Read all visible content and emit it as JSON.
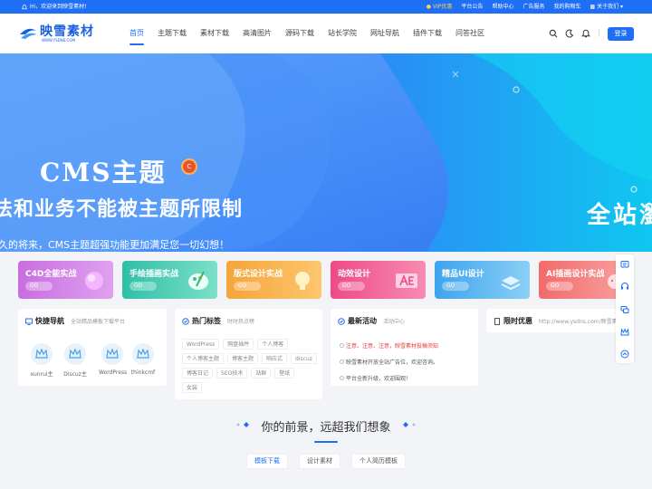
{
  "topbar": {
    "greeting": "Hi，欢迎来到映雪素材!",
    "links": [
      "VIP优惠",
      "平台公告",
      "帮助中心",
      "广告服务",
      "我的购物车",
      "关于我们"
    ]
  },
  "brand": {
    "name": "映雪素材",
    "url": "WWW.YSDNS.COM"
  },
  "nav": [
    "首页",
    "主题下载",
    "素材下载",
    "高清图片",
    "源码下载",
    "站长学院",
    "网址导航",
    "插件下载",
    "问答社区"
  ],
  "header": {
    "login_label": "登录"
  },
  "banner": {
    "title": "CMS主题",
    "badge": "C",
    "subtitle": "法和业务不能被主题所限制",
    "desc": "久的将来，CMS主题超强功能更加满足您一切幻想！",
    "right_text": "全站瀏"
  },
  "categories": [
    {
      "title": "C4D全能实战",
      "go": "GO",
      "color1": "#c86ee0",
      "color2": "#e0a0f0"
    },
    {
      "title": "手绘插画实战",
      "go": "GO",
      "color1": "#2fbfa8",
      "color2": "#7de0c8"
    },
    {
      "title": "版式设计实战",
      "go": "GO",
      "color1": "#f5a43a",
      "color2": "#fcc66e"
    },
    {
      "title": "动效设计",
      "go": "GO",
      "color1": "#ee4a86",
      "color2": "#f78bb0"
    },
    {
      "title": "精品UI设计",
      "go": "GO",
      "color1": "#3ea3ee",
      "color2": "#8ad0f6"
    },
    {
      "title": "AI插画设计实战",
      "go": "GO",
      "color1": "#f26a6a",
      "color2": "#f9a3a3"
    }
  ],
  "quick_nav": {
    "title": "快捷导航",
    "sub": "全站精品模板下载平台",
    "items": [
      "xunrui主",
      "Discuz主",
      "WordPress",
      "thinkcmf"
    ]
  },
  "hot_tags": {
    "title": "热门标签",
    "sub": "时时热点榜",
    "tags": [
      "WordPress",
      "网盘插件",
      "个人博客",
      "个人博客主题",
      "博客主题",
      "响应式",
      "discuz",
      "博客日记",
      "SEO技术",
      "站群",
      "壁纸",
      "女装"
    ]
  },
  "activity": {
    "title": "最新活动",
    "sub": "活动中心",
    "items": [
      "注意、注意、注意，映雪素材投稿须知",
      "映雪素材开放全站广告位，欢迎咨询。",
      "平台全新升级，欢迎围观！"
    ]
  },
  "promo": {
    "title": "限时优惠",
    "sub": "http://www.ysdns.com/映雪素材"
  },
  "slogan": "你的前景，远超我们想象",
  "tabs": [
    "模板下载",
    "设计素材",
    "个人简历模板"
  ],
  "colors": {
    "primary": "#1e6ff6",
    "hot": "#e53935"
  }
}
